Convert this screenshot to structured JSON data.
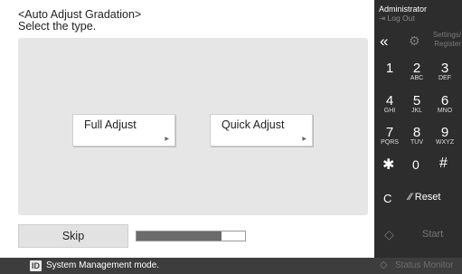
{
  "main": {
    "title": "<Auto Adjust Gradation>",
    "instruction": "Select the type.",
    "buttons": {
      "full_adjust": "Full Adjust",
      "quick_adjust": "Quick Adjust"
    },
    "skip_label": "Skip",
    "progress_fraction": 0.78
  },
  "sidebar": {
    "user": "Administrator",
    "logout": "Log Out",
    "settings_line1": "Settings/",
    "settings_line2": "Register",
    "keypad": [
      {
        "num": "1",
        "letters": ""
      },
      {
        "num": "2",
        "letters": "ABC"
      },
      {
        "num": "3",
        "letters": "DEF"
      },
      {
        "num": "4",
        "letters": "GHI"
      },
      {
        "num": "5",
        "letters": "JKL"
      },
      {
        "num": "6",
        "letters": "MNO"
      },
      {
        "num": "7",
        "letters": "PQRS"
      },
      {
        "num": "8",
        "letters": "TUV"
      },
      {
        "num": "9",
        "letters": "WXYZ"
      }
    ],
    "star": "✱",
    "zero": "0",
    "hash": "#",
    "clear": "C",
    "reset": "Reset",
    "start": "Start"
  },
  "statusbar": {
    "id_badge": "ID",
    "message": "System Management mode.",
    "monitor": "Status Monitor"
  },
  "icons": {
    "back": "double-left-chevron",
    "settings": "gear",
    "start": "diamond",
    "status_monitor": "diamond"
  },
  "colors": {
    "sidebar_bg": "#2d2d2d",
    "statusbar_bg": "#3d3d3d",
    "panel_bg": "#e6e6e6",
    "progress_fill": "#6b6b6b"
  }
}
